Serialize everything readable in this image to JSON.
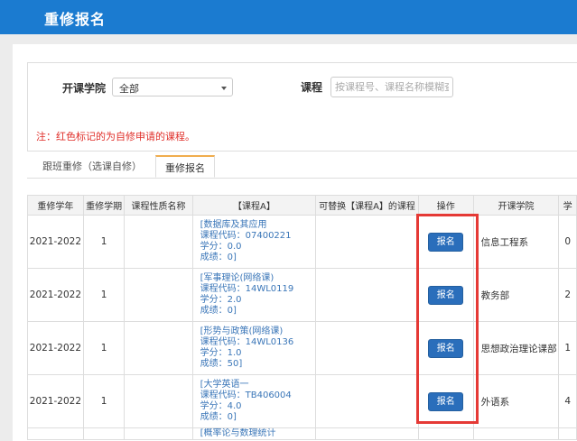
{
  "header": {
    "title": "重修报名"
  },
  "filters": {
    "college_label": "开课学院",
    "college_value": "全部",
    "course_label": "课程",
    "course_placeholder": "按课程号、课程名称模糊查"
  },
  "note": "注：红色标记的为自修申请的课程。",
  "tabs": [
    {
      "label": "跟班重修（选课自修）"
    },
    {
      "label": "重修报名"
    }
  ],
  "table": {
    "headers": [
      "重修学年",
      "重修学期",
      "课程性质名称",
      "【课程A】",
      "可替换【课程A】的课程",
      "操作",
      "开课学院",
      "学"
    ],
    "rows": [
      {
        "year": "2021-2022",
        "term": "1",
        "course_name": "[数据库及其应用",
        "code": "课程代码：07400221",
        "credit": "学分：0.0",
        "grade": "成绩：0]",
        "action": "报名",
        "college": "信息工程系",
        "extra": "0"
      },
      {
        "year": "2021-2022",
        "term": "1",
        "course_name": "[军事理论(网络课)",
        "code": "课程代码：14WL0119",
        "credit": "学分：2.0",
        "grade": "成绩：0]",
        "action": "报名",
        "college": "教务部",
        "extra": "2"
      },
      {
        "year": "2021-2022",
        "term": "1",
        "course_name": "[形势与政策(网络课)",
        "code": "课程代码：14WL0136",
        "credit": "学分：1.0",
        "grade": "成绩：50]",
        "action": "报名",
        "college": "思想政治理论课部",
        "extra": "1"
      },
      {
        "year": "2021-2022",
        "term": "1",
        "course_name": "[大学英语一",
        "code": "课程代码：TB406004",
        "credit": "学分：4.0",
        "grade": "成绩：0]",
        "action": "报名",
        "college": "外语系",
        "extra": "4"
      }
    ],
    "partial_row_text": "[概率论与数理统计"
  },
  "colors": {
    "header_bg": "#1b7bd0",
    "button_bg": "#2a6ebb",
    "highlight": "#e53935",
    "note": "#e0302b"
  }
}
